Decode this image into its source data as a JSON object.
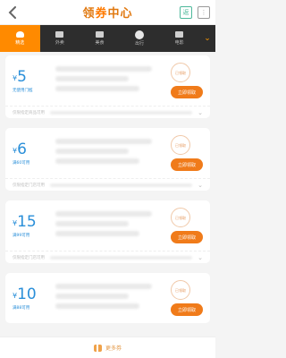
{
  "header": {
    "title_part1": "领",
    "title_part2": "券",
    "title_part3": "中心",
    "icon_right1": "返",
    "icon_right2": "⋮"
  },
  "tabs": [
    {
      "label": "精选",
      "active": true
    },
    {
      "label": "外卖"
    },
    {
      "label": "美食"
    },
    {
      "label": "出行"
    },
    {
      "label": "电影"
    }
  ],
  "coupons": [
    {
      "yen": "¥",
      "amount": "5",
      "condition": "无使用门槛",
      "stamp": "已领取",
      "claim": "立即领取",
      "footer": "仅限指定商品可用"
    },
    {
      "yen": "¥",
      "amount": "6",
      "condition": "满60可用",
      "stamp": "已领取",
      "claim": "立即领取",
      "footer": "仅限指定门店可用"
    },
    {
      "yen": "¥",
      "amount": "15",
      "condition": "满99可用",
      "stamp": "已领取",
      "claim": "立即领取",
      "footer": "仅限指定门店可用"
    },
    {
      "yen": "¥",
      "amount": "10",
      "condition": "满88可用",
      "stamp": "已领取",
      "claim": "立即领取",
      "footer": ""
    }
  ],
  "bottom": {
    "label": "更多券"
  }
}
